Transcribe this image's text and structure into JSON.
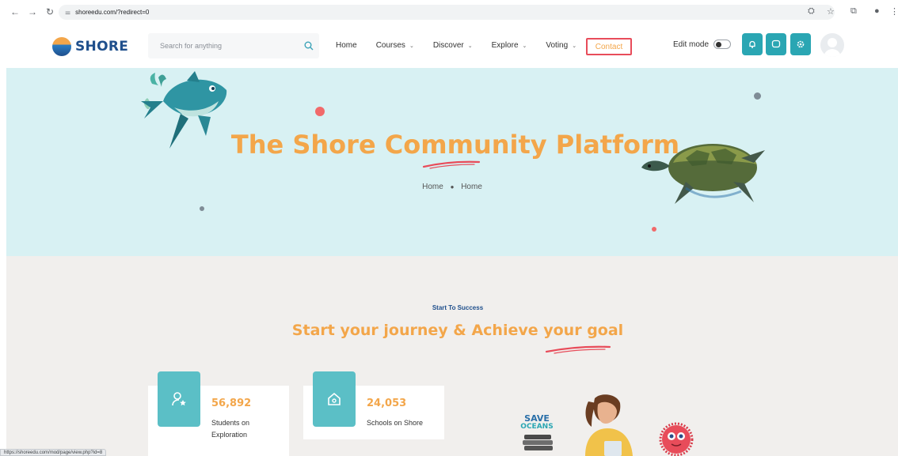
{
  "browser": {
    "url": "shoreedu.com/?redirect=0",
    "status_url": "https://shoreedu.com/mod/page/view.php?id=8"
  },
  "header": {
    "logo_text": "SHORE",
    "search_placeholder": "Search for anything",
    "menu": [
      {
        "label": "Home",
        "has_dropdown": false
      },
      {
        "label": "Courses",
        "has_dropdown": true
      },
      {
        "label": "Discover",
        "has_dropdown": true
      },
      {
        "label": "Explore",
        "has_dropdown": true
      },
      {
        "label": "Voting",
        "has_dropdown": true
      }
    ],
    "contact_label": "Contact",
    "edit_mode_label": "Edit mode",
    "edit_mode_on": false,
    "icon_buttons": [
      "bell-icon",
      "chat-icon",
      "settings-icon"
    ]
  },
  "hero": {
    "title": "The Shore Community Platform",
    "breadcrumb": [
      "Home",
      "Home"
    ]
  },
  "section": {
    "eyebrow": "Start To Success",
    "title": "Start your journey & Achieve your goal",
    "stats": [
      {
        "number": "56,892",
        "label_line1": "Students on",
        "label_line2": "Exploration",
        "icon": "student-icon"
      },
      {
        "number": "24,053",
        "label_line1": "Schools on Shore",
        "label_line2": "",
        "icon": "school-icon"
      }
    ],
    "badge_text_1": "SAVE",
    "badge_text_2": "OCEANS"
  },
  "colors": {
    "accent": "#f3a64a",
    "teal": "#2aa6b3",
    "navy": "#1f4f8c",
    "hero_bg": "#d8f1f3",
    "section_bg": "#f1efed",
    "contact_outline": "#e84c5a"
  }
}
